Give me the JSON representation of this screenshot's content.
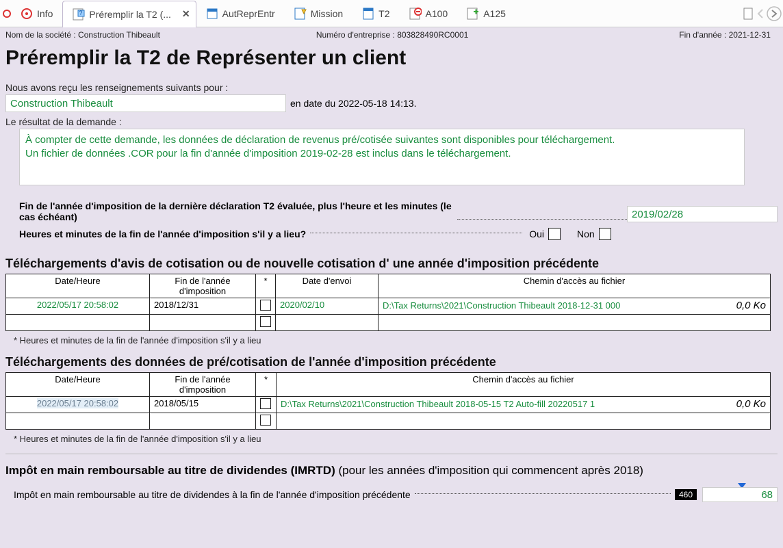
{
  "tabs": {
    "info": "Info",
    "active": "Préremplir la T2 (...",
    "autre": "AutReprEntr",
    "mission": "Mission",
    "t2": "T2",
    "a100": "A100",
    "a125": "A125"
  },
  "meta": {
    "company_label": "Nom de la société : Construction Thibeault",
    "bn_label": "Numéro d'entreprise : 803828490RC0001",
    "fye_label": "Fin d'année : 2021-12-31"
  },
  "page_title": "Préremplir la T2 de Représenter un client",
  "intro": {
    "line1": "Nous avons reçu les renseignements suivants pour :",
    "company_value": "Construction Thibeault",
    "asof": "en date du 2022-05-18 14:13.",
    "result_label": "Le résultat de la demande :",
    "result_text_1": "À compter de cette demande, les données de déclaration de revenus pré/cotisée suivantes sont disponibles pour téléchargement.",
    "result_text_2": "Un fichier de données .COR pour la fin d'année d'imposition 2019-02-28 est inclus dans le téléchargement."
  },
  "fields": {
    "last_fye_label": "Fin de l'année d'imposition de la dernière déclaration T2 évaluée, plus l'heure et les minutes (le cas échéant)",
    "last_fye_value": "2019/02/28",
    "hm_label": "Heures et minutes de la fin de l'année d'imposition s'il y a lieu?",
    "oui": "Oui",
    "non": "Non"
  },
  "section1": {
    "heading": "Téléchargements d'avis de cotisation ou de nouvelle cotisation d' une année d'imposition précédente",
    "footnote": "* Heures et minutes de la fin de l'année d'imposition s'il y a lieu",
    "headers": {
      "datetime": "Date/Heure",
      "fye": "Fin de l'année d'imposition",
      "star": "*",
      "sent": "Date d'envoi",
      "path": "Chemin d'accès au fichier"
    },
    "rows": [
      {
        "datetime": "2022/05/17 20:58:02",
        "fye": "2018/12/31",
        "sent": "2020/02/10",
        "path": "D:\\Tax Returns\\2021\\Construction Thibeault 2018-12-31 000",
        "size": "0,0 Ko"
      },
      {
        "datetime": "",
        "fye": "",
        "sent": "",
        "path": "",
        "size": ""
      }
    ]
  },
  "section2": {
    "heading": "Téléchargements des données de pré/cotisation de l'année d'imposition précédente",
    "footnote": "* Heures et minutes de la fin de l'année d'imposition s'il y a lieu",
    "headers": {
      "datetime": "Date/Heure",
      "fye": "Fin de l'année d'imposition",
      "star": "*",
      "path": "Chemin d'accès au fichier"
    },
    "rows": [
      {
        "datetime": "2022/05/17 20:58:02",
        "fye": "2018/05/15",
        "path": "D:\\Tax Returns\\2021\\Construction Thibeault 2018-05-15 T2 Auto-fill 20220517 1",
        "size": "0,0 Ko"
      },
      {
        "datetime": "",
        "fye": "",
        "path": "",
        "size": ""
      }
    ]
  },
  "imrtd": {
    "title_bold": "Impôt en main remboursable au titre de dividendes (IMRTD)",
    "title_rest": " (pour les années d'imposition qui commencent après 2018)",
    "row_label": "Impôt en main remboursable au titre de dividendes à la fin de l'année d'imposition précédente",
    "line_no": "460",
    "value": "68"
  }
}
